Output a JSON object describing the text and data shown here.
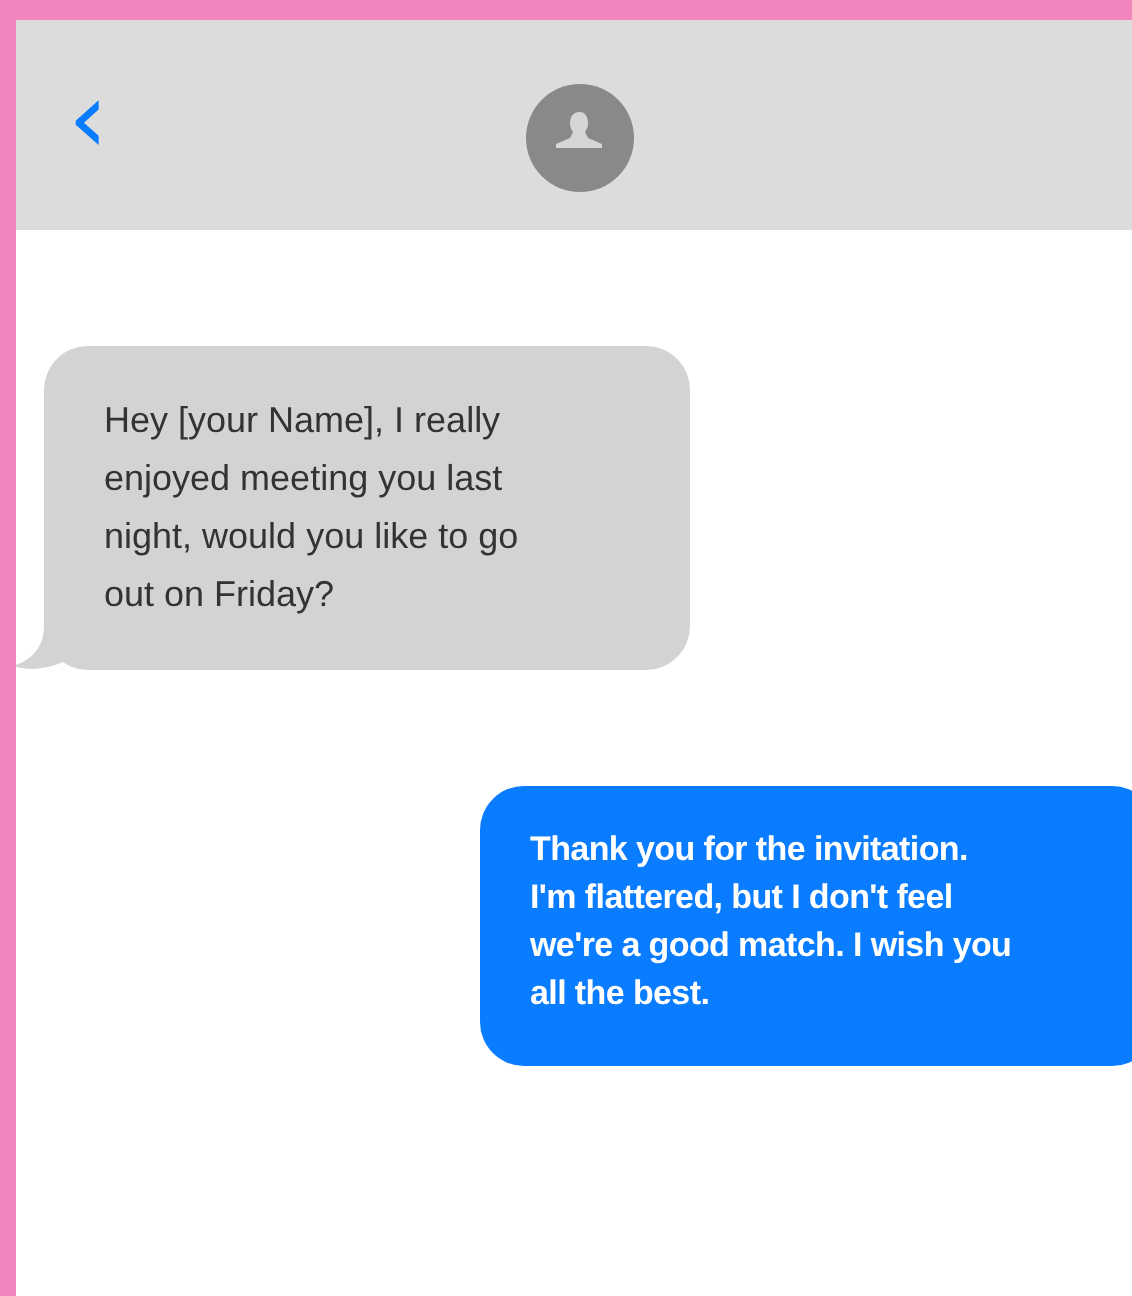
{
  "header": {
    "back": "‹"
  },
  "messages": [
    {
      "kind": "incoming",
      "text": "Hey [your Name], I really\nenjoyed meeting you last\nnight, would you like to go\nout on Friday?"
    },
    {
      "kind": "outgoing",
      "text": "Thank you for the invitation.\nI'm flattered, but I don't feel\nwe're a good match. I wish you\nall the best."
    }
  ]
}
